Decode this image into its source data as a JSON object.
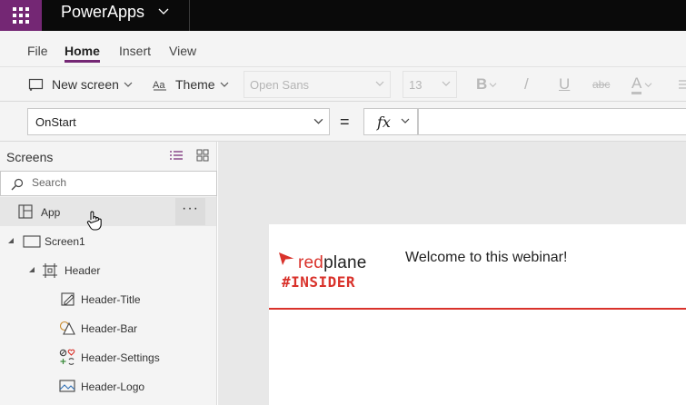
{
  "app": {
    "name": "PowerApps",
    "waffle_icon": "waffle-icon",
    "brand_color": "#742774"
  },
  "tabs": [
    {
      "label": "File",
      "active": false
    },
    {
      "label": "Home",
      "active": true
    },
    {
      "label": "Insert",
      "active": false
    },
    {
      "label": "View",
      "active": false
    }
  ],
  "ribbon": {
    "new_screen": "New screen",
    "theme": "Theme",
    "font_family": "Open Sans",
    "font_size": "13",
    "bold": "B",
    "italic": "/",
    "underline": "U",
    "strike": "abc",
    "font_color": "A"
  },
  "formula": {
    "property": "OnStart",
    "equals": "=",
    "fx": "fx",
    "value": ""
  },
  "screens_panel": {
    "title": "Screens",
    "search_placeholder": "Search",
    "more_label": "···",
    "items": [
      {
        "label": "App",
        "icon": "app-icon"
      },
      {
        "label": "Screen1",
        "icon": "screen-icon"
      },
      {
        "label": "Header",
        "icon": "group-icon"
      },
      {
        "label": "Header-Title",
        "icon": "edit-text-icon"
      },
      {
        "label": "Header-Bar",
        "icon": "shapes-icon"
      },
      {
        "label": "Header-Settings",
        "icon": "icons-icon"
      },
      {
        "label": "Header-Logo",
        "icon": "image-icon"
      }
    ]
  },
  "canvas": {
    "logo_word_a": "red",
    "logo_word_b": "plane",
    "logo_tag": "#INSIDER",
    "title": "Welcome to this webinar!",
    "accent_color": "#d9322b"
  }
}
